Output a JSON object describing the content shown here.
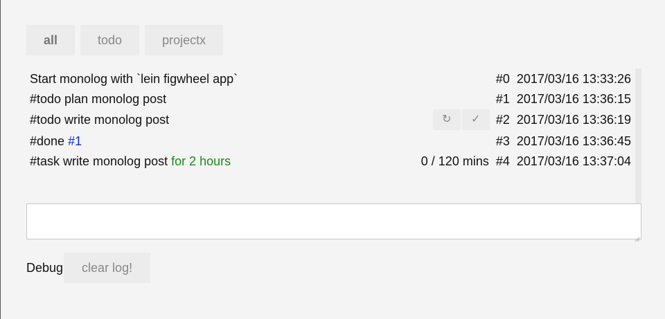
{
  "tabs": [
    {
      "label": "all",
      "active": true
    },
    {
      "label": "todo",
      "active": false
    },
    {
      "label": "projectx",
      "active": false
    }
  ],
  "log": [
    {
      "text": "Start monolog with `lein figwheel app`",
      "id": "#0",
      "timestamp": "2017/03/16 13:33:26"
    },
    {
      "text": "#todo plan monolog post",
      "id": "#1",
      "timestamp": "2017/03/16 13:36:15"
    },
    {
      "text": "#todo write monolog post",
      "id": "#2",
      "timestamp": "2017/03/16 13:36:19",
      "actions": {
        "redo": "↻",
        "done": "✓"
      }
    },
    {
      "text_prefix": "#done ",
      "ref": "#1",
      "id": "#3",
      "timestamp": "2017/03/16 13:36:45"
    },
    {
      "text_prefix": "#task write monolog post ",
      "duration": "for 2 hours",
      "progress": "0 / 120 mins",
      "id": "#4",
      "timestamp": "2017/03/16 13:37:04"
    }
  ],
  "input": {
    "value": "",
    "placeholder": ""
  },
  "debug": {
    "label": "Debug",
    "clear_button": "clear log!"
  }
}
